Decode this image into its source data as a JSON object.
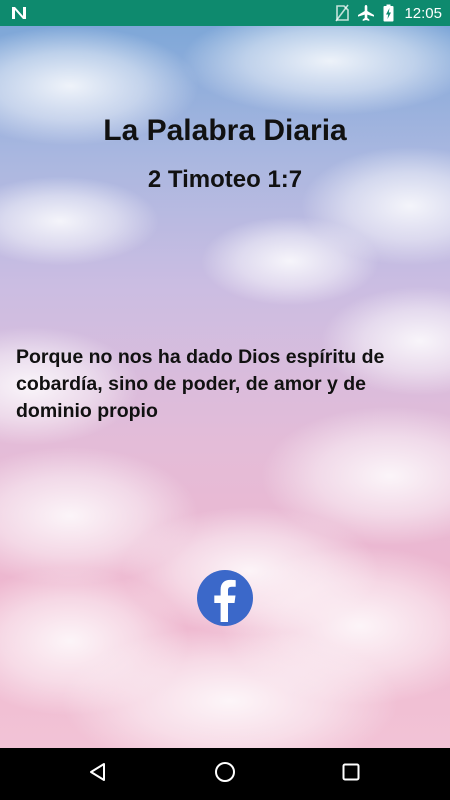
{
  "status_bar": {
    "time": "12:05",
    "app_notification_icon": "n-app-icon",
    "icons": [
      "sim-off-icon",
      "airplane-mode-icon",
      "battery-charging-icon"
    ],
    "background_color": "#0e8a6e"
  },
  "content": {
    "title": "La Palabra Diaria",
    "reference": "2 Timoteo 1:7",
    "verse": "Porque no nos ha dado Dios espíritu de cobardía, sino de poder, de amor y de dominio propio"
  },
  "share": {
    "icon": "facebook-icon",
    "color": "#3b68c9"
  },
  "nav_bar": {
    "icons": [
      "back-icon",
      "home-icon",
      "recents-icon"
    ]
  }
}
